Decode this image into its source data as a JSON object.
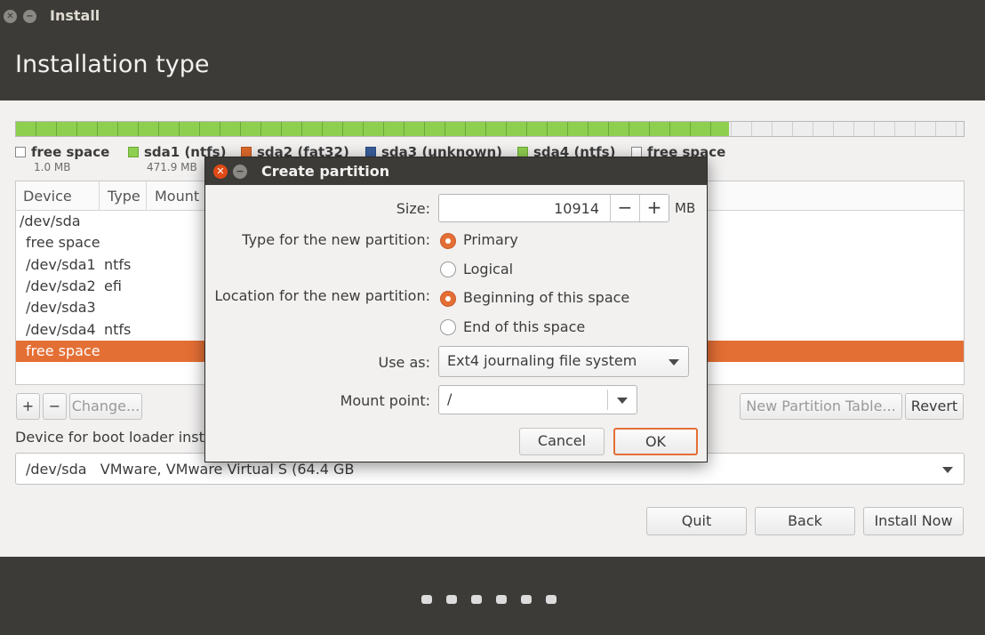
{
  "window": {
    "title": "Install"
  },
  "page": {
    "title": "Installation type"
  },
  "partition_bar": {
    "used_fraction": 0.752
  },
  "legend": [
    {
      "label": "free space",
      "size": "1.0 MB",
      "color": "#ffffff"
    },
    {
      "label": "sda1 (ntfs)",
      "size": "471.9 MB",
      "color": "#8fcf4f"
    },
    {
      "label": "sda2 (fat32)",
      "color": "#e06b2b"
    },
    {
      "label": "sda3 (unknown)",
      "color": "#3a5f9c"
    },
    {
      "label": "sda4 (ntfs)",
      "color": "#8fcf4f"
    },
    {
      "label": "free space",
      "color": "#ffffff"
    }
  ],
  "table": {
    "headers": {
      "device": "Device",
      "type": "Type",
      "mount": "Mount"
    },
    "rows": [
      {
        "device": "/dev/sda",
        "type": ""
      },
      {
        "device": "free space",
        "type": ""
      },
      {
        "device": "/dev/sda1",
        "type": "ntfs"
      },
      {
        "device": "/dev/sda2",
        "type": "efi"
      },
      {
        "device": "/dev/sda3",
        "type": ""
      },
      {
        "device": "/dev/sda4",
        "type": "ntfs"
      },
      {
        "device": "free space",
        "type": ""
      }
    ]
  },
  "table_buttons": {
    "add": "+",
    "remove": "−",
    "change": "Change...",
    "new_table": "New Partition Table...",
    "revert": "Revert"
  },
  "boot_loader": {
    "label": "Device for boot loader installation:",
    "value": "/dev/sda   VMware, VMware Virtual S (64.4 GB"
  },
  "nav": {
    "quit": "Quit",
    "back": "Back",
    "install": "Install Now"
  },
  "dialog": {
    "title": "Create partition",
    "size_label": "Size:",
    "size_value": "10914",
    "minus": "−",
    "plus": "+",
    "size_unit": "MB",
    "type_label": "Type for the new partition:",
    "type_primary": "Primary",
    "type_logical": "Logical",
    "location_label": "Location for the new partition:",
    "location_begin": "Beginning of this space",
    "location_end": "End of this space",
    "use_as_label": "Use as:",
    "use_as_value": "Ext4 journaling file system",
    "mount_label": "Mount point:",
    "mount_value": "/",
    "cancel": "Cancel",
    "ok": "OK"
  },
  "progress_dots": 6,
  "colors": {
    "accent": "#e46f35",
    "chrome": "#3c3b37"
  }
}
